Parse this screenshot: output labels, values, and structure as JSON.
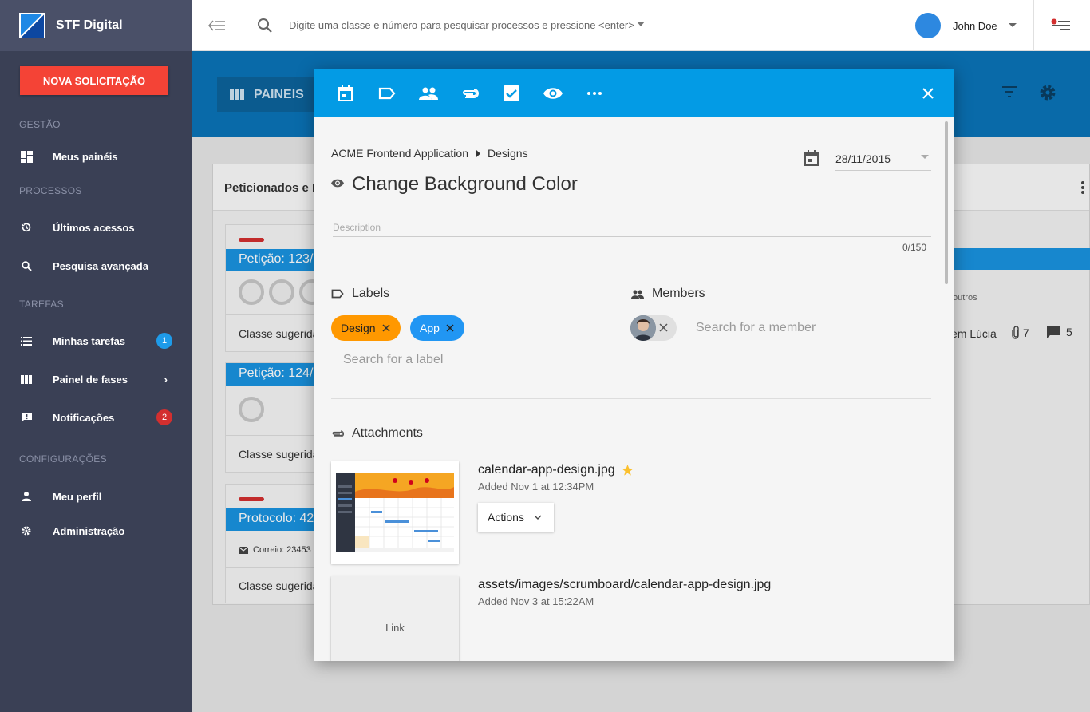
{
  "sidebar": {
    "brand": "STF Digital",
    "new_button": "NOVA SOLICITAÇÃO",
    "sections": {
      "gestao": "GESTÃO",
      "processos": "PROCESSOS",
      "tarefas": "TAREFAS",
      "config": "CONFIGURAÇÕES"
    },
    "items": {
      "meus_paineis": "Meus painéis",
      "ultimos": "Últimos acessos",
      "pesquisa": "Pesquisa avançada",
      "minhas_tarefas": "Minhas tarefas",
      "painel_fases": "Painel de fases",
      "notificacoes": "Notificações",
      "meu_perfil": "Meu perfil",
      "administracao": "Administração"
    },
    "badges": {
      "tarefas": "1",
      "notificacoes": "2"
    },
    "badge_colors": {
      "tarefas": "#1e9be9",
      "notificacoes": "#d32f2f"
    }
  },
  "topbar": {
    "search_placeholder": "Digite uma classe e número para pesquisar processos e pressione <enter>",
    "user_name": "John Doe"
  },
  "background": {
    "paineis": "PAINEIS",
    "panel_title": "Peticionados e R",
    "cards": [
      {
        "title": "Petição: 123/",
        "footer": "Classe sugerida"
      },
      {
        "title": "Petição: 124/",
        "footer": "Classe sugerida"
      },
      {
        "title": "Protocolo: 42",
        "mail": "Correio: 23453",
        "footer": "Classe sugerida"
      }
    ],
    "right_outros": "outros",
    "right_name": "em Lúcia",
    "right_clips": "7",
    "right_comments": "5"
  },
  "dialog": {
    "breadcrumb": {
      "project": "ACME Frontend Application",
      "list": "Designs"
    },
    "due_date": "28/11/2015",
    "title": "Change Background Color",
    "description_label": "Description",
    "char_count": "0/150",
    "labels_heading": "Labels",
    "labels": [
      {
        "name": "Design",
        "color": "#ff9800"
      },
      {
        "name": "App",
        "color": "#2196f3"
      }
    ],
    "label_search_placeholder": "Search for a label",
    "members_heading": "Members",
    "member_search_placeholder": "Search for a member",
    "attachments_heading": "Attachments",
    "attachments": [
      {
        "name": "calendar-app-design.jpg",
        "added": "Added Nov 1 at 12:34PM",
        "starred": true,
        "actions": "Actions"
      },
      {
        "name": "assets/images/scrumboard/calendar-app-design.jpg",
        "added": "Added Nov 3 at 15:22AM",
        "preview_label": "Link"
      }
    ],
    "toolbar_color": "#039be5"
  }
}
